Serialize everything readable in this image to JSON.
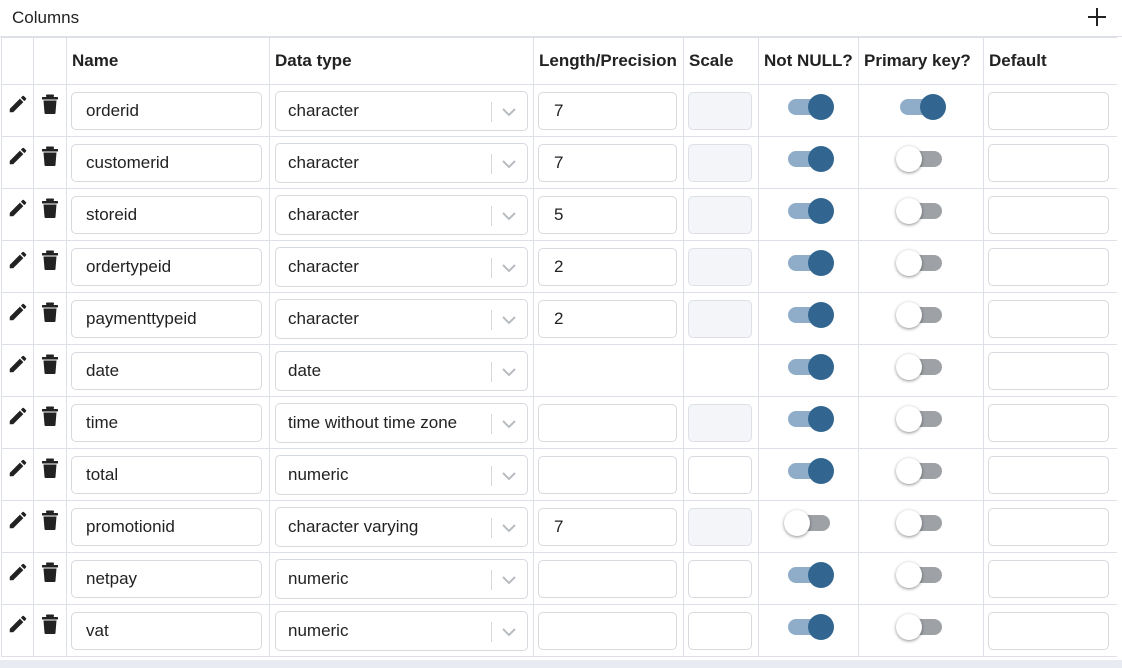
{
  "header": {
    "title": "Columns",
    "add_icon": "plus-icon"
  },
  "columns": {
    "headers": [
      "",
      "",
      "Name",
      "Data type",
      "Length/Precision",
      "Scale",
      "Not NULL?",
      "Primary key?",
      "Default"
    ],
    "rows": [
      {
        "name": "orderid",
        "data_type": "character",
        "length": "7",
        "scale_disabled": true,
        "length_visible": true,
        "scale_visible": true,
        "not_null": true,
        "primary_key": true,
        "default": ""
      },
      {
        "name": "customerid",
        "data_type": "character",
        "length": "7",
        "scale_disabled": true,
        "length_visible": true,
        "scale_visible": true,
        "not_null": true,
        "primary_key": false,
        "default": ""
      },
      {
        "name": "storeid",
        "data_type": "character",
        "length": "5",
        "scale_disabled": true,
        "length_visible": true,
        "scale_visible": true,
        "not_null": true,
        "primary_key": false,
        "default": ""
      },
      {
        "name": "ordertypeid",
        "data_type": "character",
        "length": "2",
        "scale_disabled": true,
        "length_visible": true,
        "scale_visible": true,
        "not_null": true,
        "primary_key": false,
        "default": ""
      },
      {
        "name": "paymenttypeid",
        "data_type": "character",
        "length": "2",
        "scale_disabled": true,
        "length_visible": true,
        "scale_visible": true,
        "not_null": true,
        "primary_key": false,
        "default": ""
      },
      {
        "name": "date",
        "data_type": "date",
        "length": "",
        "scale_disabled": false,
        "length_visible": false,
        "scale_visible": false,
        "not_null": true,
        "primary_key": false,
        "default": ""
      },
      {
        "name": "time",
        "data_type": "time without time zone",
        "length": "",
        "scale_disabled": true,
        "length_visible": true,
        "scale_visible": true,
        "not_null": true,
        "primary_key": false,
        "default": ""
      },
      {
        "name": "total",
        "data_type": "numeric",
        "length": "",
        "scale_disabled": false,
        "length_visible": true,
        "scale_visible": true,
        "not_null": true,
        "primary_key": false,
        "default": ""
      },
      {
        "name": "promotionid",
        "data_type": "character varying",
        "length": "7",
        "scale_disabled": true,
        "length_visible": true,
        "scale_visible": true,
        "not_null": false,
        "primary_key": false,
        "default": ""
      },
      {
        "name": "netpay",
        "data_type": "numeric",
        "length": "",
        "scale_disabled": false,
        "length_visible": true,
        "scale_visible": true,
        "not_null": true,
        "primary_key": false,
        "default": ""
      },
      {
        "name": "vat",
        "data_type": "numeric",
        "length": "",
        "scale_disabled": false,
        "length_visible": true,
        "scale_visible": true,
        "not_null": true,
        "primary_key": false,
        "default": ""
      }
    ]
  },
  "colors": {
    "toggle_on_knob": "#326690",
    "toggle_on_track": "#8fadc8",
    "toggle_off_track": "#9ea1a6",
    "border": "#dde0e6"
  },
  "icons": {
    "edit": "pencil-icon",
    "delete": "trash-icon",
    "dropdown": "chevron-down-icon"
  }
}
